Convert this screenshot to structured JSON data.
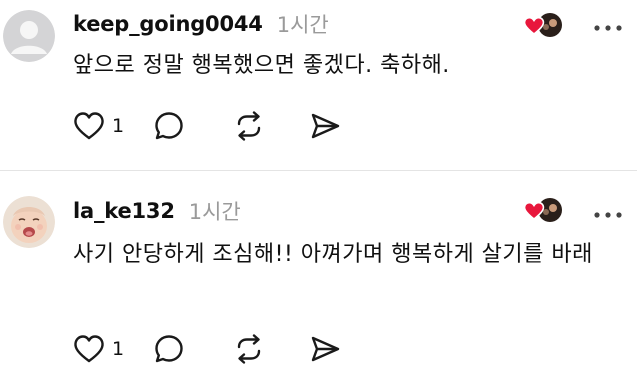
{
  "comments": [
    {
      "username": "keep_going0044",
      "time": "1시간",
      "text": "앞으로 정말 행복했으면 좋겠다. 축하해.",
      "like_count": "1",
      "avatar_icon": "default-user-avatar"
    },
    {
      "username": "la_ke132",
      "time": "1시간",
      "text": "사기 안당하게 조심해!! 아껴가며 행복하게 살기를 바래",
      "like_count": "1",
      "avatar_icon": "baby-photo-avatar"
    }
  ],
  "colors": {
    "heart": "#e8173c",
    "muted": "#9a9a9a",
    "text": "#101010",
    "divider": "#e4e4e4"
  }
}
